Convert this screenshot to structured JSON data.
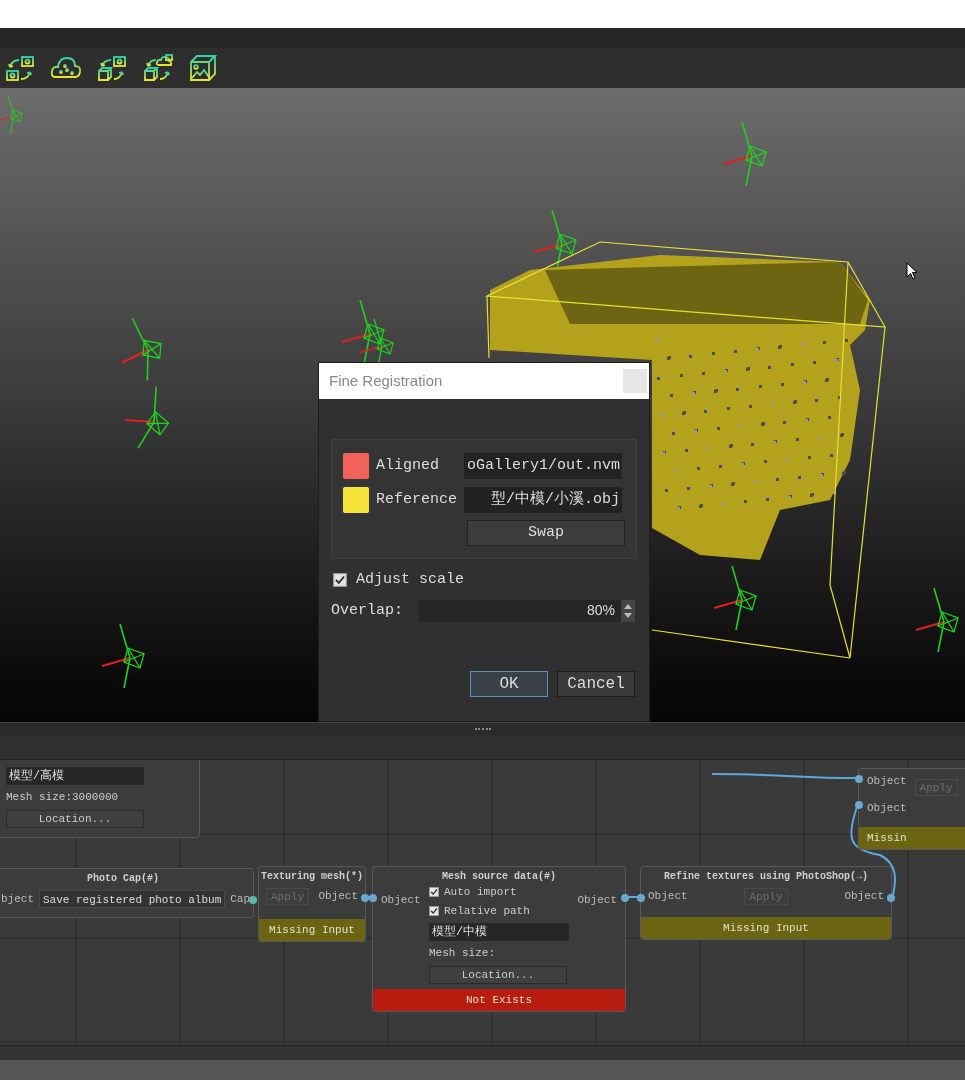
{
  "dialog": {
    "title": "Fine Registration",
    "items": [
      {
        "label": "Aligned",
        "color": "#f0625a",
        "path": "oGallery1/out.nvm"
      },
      {
        "label": "Reference",
        "color": "#f6e43a",
        "path": "型/中模/小溪.obj"
      }
    ],
    "swap_button": "Swap",
    "adjust_scale": {
      "label": "Adjust scale",
      "checked": true
    },
    "overlap": {
      "label": "Overlap:",
      "value": "80%"
    },
    "buttons": [
      {
        "label": "OK",
        "selected": true
      },
      {
        "label": "Cancel",
        "selected": false
      }
    ]
  },
  "node_graph": {
    "nodes": [
      {
        "kind": "mesh_partial",
        "field": "模型/高模",
        "mesh_size": "Mesh size:3000000",
        "button": "Location..."
      },
      {
        "kind": "photo_cap",
        "title": "Photo Cap(#)",
        "input": "bject",
        "field": "Save registered photo album",
        "output": "Cap"
      },
      {
        "kind": "process",
        "title": "Texturing mesh(*)",
        "apply": {
          "label": "Apply",
          "disabled": true
        },
        "output": "Object",
        "status": "Missing Input",
        "color": "#6b6512"
      },
      {
        "kind": "source",
        "title": "Mesh source data(#)",
        "input": "Object",
        "output": "Object",
        "checks": [
          {
            "label": "Auto import",
            "checked": true
          },
          {
            "label": "Relative path",
            "checked": true
          }
        ],
        "field": "模型/中模",
        "mesh_size": "Mesh size:",
        "button": "Location...",
        "status": "Not Exists",
        "color": "#b81c0e"
      },
      {
        "kind": "process",
        "title": "Refine textures using PhotoShop(→)",
        "input": "Object",
        "apply": {
          "label": "Apply",
          "disabled": true
        },
        "output": "Object",
        "status": "Missing Input",
        "color": "#6b6512"
      },
      {
        "kind": "right_partial",
        "inputs": [
          "Object",
          "Object"
        ],
        "apply": {
          "label": "Apply",
          "disabled": true
        },
        "status": "Missin",
        "color": "#6b6512"
      }
    ]
  }
}
